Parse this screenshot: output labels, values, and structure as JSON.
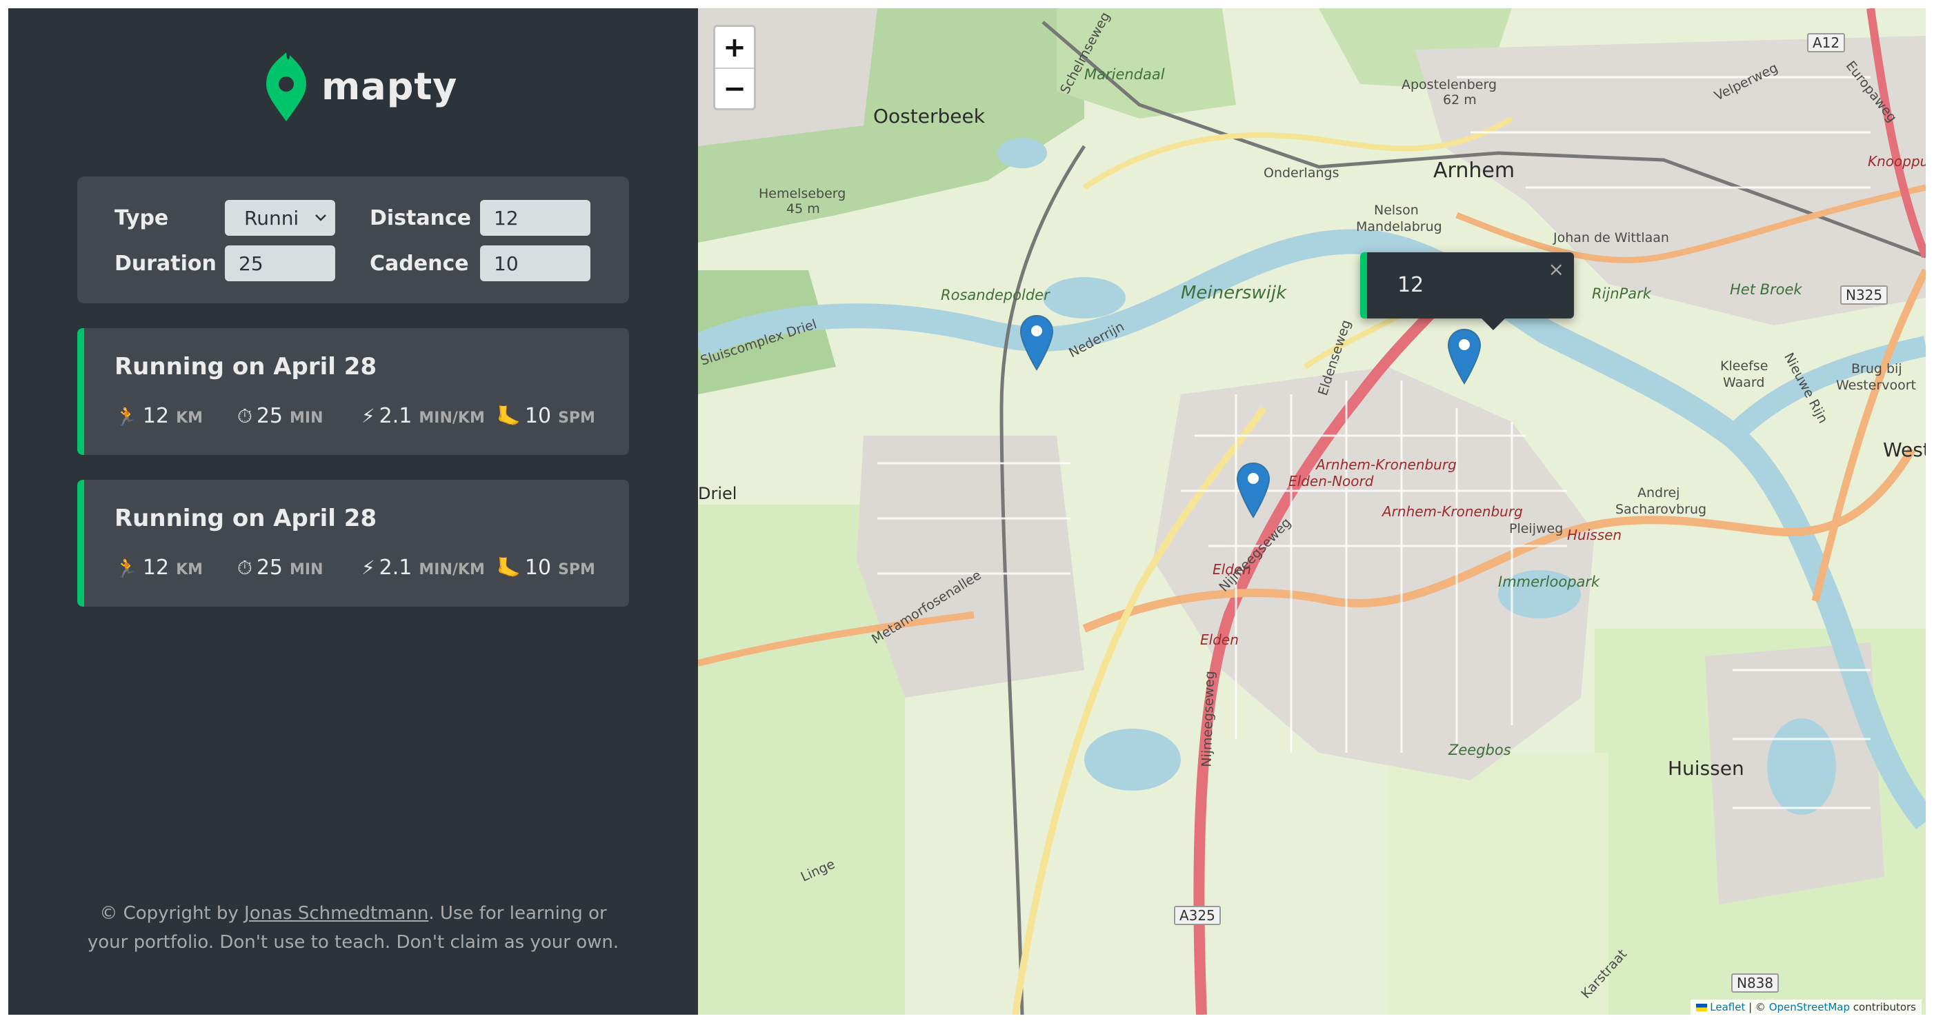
{
  "app": {
    "name": "mapty"
  },
  "colors": {
    "sidebar": "#2d3439",
    "card": "#42484d",
    "accent": "#00c46a",
    "text": "#ececec",
    "muted": "#aaaaaa",
    "input": "#d6dee0"
  },
  "form": {
    "type_label": "Type",
    "type_value": "Runni",
    "distance_label": "Distance",
    "distance_value": "12",
    "duration_label": "Duration",
    "duration_value": "25",
    "cadence_label": "Cadence",
    "cadence_value": "10"
  },
  "workouts": [
    {
      "title": "Running on April 28",
      "distance": "12",
      "distance_unit": "KM",
      "duration": "25",
      "duration_unit": "MIN",
      "pace": "2.1",
      "pace_unit": "MIN/KM",
      "cadence": "10",
      "cadence_unit": "SPM",
      "icons": [
        "runner-icon",
        "stopwatch-icon",
        "lightning-icon",
        "foot-icon"
      ]
    },
    {
      "title": "Running on April 28",
      "distance": "12",
      "distance_unit": "KM",
      "duration": "25",
      "duration_unit": "MIN",
      "pace": "2.1",
      "pace_unit": "MIN/KM",
      "cadence": "10",
      "cadence_unit": "SPM",
      "icons": [
        "runner-icon",
        "stopwatch-icon",
        "lightning-icon",
        "foot-icon"
      ]
    }
  ],
  "copyright": {
    "prefix": "© Copyright by ",
    "author": "Jonas Schmedtmann",
    "suffix": ". Use for learning or your portfolio. Don't use to teach. Don't claim as your own."
  },
  "map": {
    "zoom_in": "+",
    "zoom_out": "−",
    "popup_text": "12",
    "popup_close": "×",
    "attribution": {
      "leaflet": "Leaflet",
      "separator": " | © ",
      "osm": "OpenStreetMap",
      "suffix": " contributors"
    },
    "labels": {
      "oosterbeek": "Oosterbeek",
      "arnhem": "Arnhem",
      "apostelenberg": "Apostelenberg",
      "apostelenberg_height": "62 m",
      "hemelseberg": "Hemelseberg",
      "hemelseberg_height": "45 m",
      "mariendaal": "Mariendaal",
      "nelson": "Nelson",
      "mandelabrug": "Mandelabrug",
      "onderlangs": "Onderlangs",
      "johan": "Johan de Wittlaan",
      "rosandepolder": "Rosandepolder",
      "meinerswijk": "Meinerswijk",
      "rijnpark": "RijnPark",
      "het_broek": "Het Broek",
      "kleefse": "Kleefse",
      "waard": "Waard",
      "brug1": "Brug bij",
      "brug2": "Westervoort",
      "weste": "Weste",
      "driel": "Driel",
      "arnhem_kronenburg": "Arnhem-Kronenburg",
      "elden_noord": "Elden-Noord",
      "arnhem_kronenburg2": "Arnhem-Kronenburg",
      "elden": "Elden",
      "elden2": "Elden",
      "andrej": "Andrej",
      "sacharovbrug": "Sacharovbrug",
      "huissen_road": "Huissen",
      "pleijweg": "Pleijweg",
      "immerloopark": "Immerloopark",
      "metamorfosenallee": "Metamorfosenallee",
      "nijmeegseweg": "Nijmeegseweg",
      "nijmeegseweg2": "Nijmeegseweg",
      "zeegbos": "Zeegbos",
      "huissen": "Huissen",
      "a325": "A325",
      "n325": "N325",
      "a12": "A12",
      "n838": "N838",
      "knooppun": "Knooppun",
      "eldenseweg": "Eldenseweg",
      "sluiscomplex": "Sluiscomplex Driel",
      "nederrijn": "Nederrijn",
      "linge": "Linge",
      "karstraat": "Karstraat",
      "velperweg": "Velperweg",
      "schelmseweg": "Schelmseweg",
      "europaweg": "Europaweg",
      "nieuwe_rijn": "Nieuwe Rijn"
    }
  }
}
